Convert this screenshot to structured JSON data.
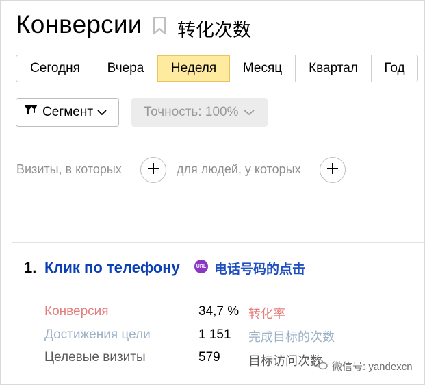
{
  "header": {
    "title": "Конверсии",
    "title_cn": "转化次数",
    "bookmark_icon": "bookmark-icon"
  },
  "periods": [
    {
      "label": "Сегодня",
      "active": false
    },
    {
      "label": "Вчера",
      "active": false
    },
    {
      "label": "Неделя",
      "active": true
    },
    {
      "label": "Месяц",
      "active": false
    },
    {
      "label": "Квартал",
      "active": false
    },
    {
      "label": "Год",
      "active": false
    }
  ],
  "filters": {
    "segment_label": "Сегмент",
    "accuracy_label": "Точность: 100%"
  },
  "conditions": {
    "visits_label": "Визиты, в которых",
    "people_label": "для людей, у которых"
  },
  "goal": {
    "number": "1.",
    "name": "Клик по телефону",
    "badge": "URL",
    "name_cn": "电话号码的点击"
  },
  "metrics": [
    {
      "label": "Конверсия",
      "value": "34,7 %",
      "cn": "转化率",
      "label_color": "#e57d7d",
      "cn_color": "#e57d7d"
    },
    {
      "label": "Достижения цели",
      "value": "1 151",
      "cn": "完成目标的次数",
      "label_color": "#9cb2c6",
      "cn_color": "#9cb2c6"
    },
    {
      "label": "Целевые визиты",
      "value": "579",
      "cn": "目标访问次数",
      "label_color": "#5a5a5a",
      "cn_color": "#5a5a5a"
    }
  ],
  "watermark": {
    "text": "微信号: yandexcn"
  },
  "colors": {
    "active_period": "#ffeba0",
    "goal_link": "#0b3fb5",
    "url_badge": "#8a38c4"
  }
}
